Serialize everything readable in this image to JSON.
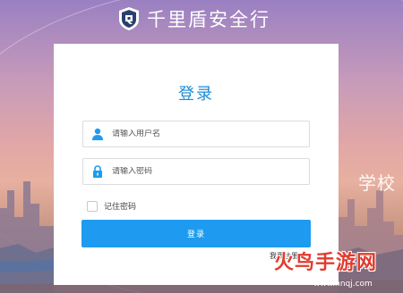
{
  "header": {
    "title": "千里盾安全行"
  },
  "login": {
    "title": "登录",
    "username_placeholder": "请输入用户名",
    "password_placeholder": "请输入密码",
    "remember_label": "记住密码",
    "submit_label": "登录",
    "register_link": "我要注册<"
  },
  "background": {
    "side_text": "学校"
  },
  "watermark": {
    "main": "火鸟手游网",
    "sub": "www.hnqj.com"
  },
  "colors": {
    "accent": "#1e9bf0",
    "title": "#1a8cd8"
  },
  "icons": {
    "logo": "shield-logo-icon",
    "user": "user-icon",
    "lock": "lock-icon",
    "checkbox": "checkbox-icon"
  }
}
